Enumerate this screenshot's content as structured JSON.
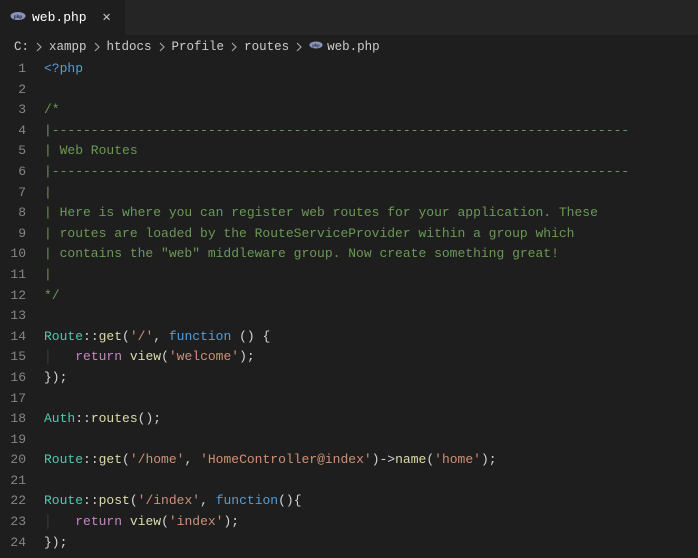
{
  "tab": {
    "filename": "web.php",
    "close_glyph": "✕"
  },
  "breadcrumb": {
    "items": [
      "C:",
      "xampp",
      "htdocs",
      "Profile",
      "routes",
      "web.php"
    ]
  },
  "code": {
    "lines": [
      {
        "n": 1,
        "tokens": [
          [
            "c-tag",
            "<?php"
          ]
        ]
      },
      {
        "n": 2,
        "tokens": []
      },
      {
        "n": 3,
        "tokens": [
          [
            "c-comment",
            "/*"
          ]
        ]
      },
      {
        "n": 4,
        "tokens": [
          [
            "c-comment",
            "|--------------------------------------------------------------------------"
          ]
        ]
      },
      {
        "n": 5,
        "tokens": [
          [
            "c-comment",
            "| Web Routes"
          ]
        ]
      },
      {
        "n": 6,
        "tokens": [
          [
            "c-comment",
            "|--------------------------------------------------------------------------"
          ]
        ]
      },
      {
        "n": 7,
        "tokens": [
          [
            "c-comment",
            "|"
          ]
        ]
      },
      {
        "n": 8,
        "tokens": [
          [
            "c-comment",
            "| Here is where you can register web routes for your application. These"
          ]
        ]
      },
      {
        "n": 9,
        "tokens": [
          [
            "c-comment",
            "| routes are loaded by the RouteServiceProvider within a group which"
          ]
        ]
      },
      {
        "n": 10,
        "tokens": [
          [
            "c-comment",
            "| contains the \"web\" middleware group. Now create something great!"
          ]
        ]
      },
      {
        "n": 11,
        "tokens": [
          [
            "c-comment",
            "|"
          ]
        ]
      },
      {
        "n": 12,
        "tokens": [
          [
            "c-comment",
            "*/"
          ]
        ]
      },
      {
        "n": 13,
        "tokens": []
      },
      {
        "n": 14,
        "tokens": [
          [
            "c-type",
            "Route"
          ],
          [
            "c-punct",
            "::"
          ],
          [
            "c-func",
            "get"
          ],
          [
            "c-punct",
            "("
          ],
          [
            "c-str",
            "'/'"
          ],
          [
            "c-punct",
            ", "
          ],
          [
            "c-keyword",
            "function"
          ],
          [
            "c-punct",
            " () {"
          ]
        ]
      },
      {
        "n": 15,
        "tokens": [
          [
            "guide",
            "│   "
          ],
          [
            "c-keyword2",
            "return"
          ],
          [
            "c-punct",
            " "
          ],
          [
            "c-func",
            "view"
          ],
          [
            "c-punct",
            "("
          ],
          [
            "c-str",
            "'welcome'"
          ],
          [
            "c-punct",
            ");"
          ]
        ]
      },
      {
        "n": 16,
        "tokens": [
          [
            "c-punct",
            "});"
          ]
        ]
      },
      {
        "n": 17,
        "tokens": []
      },
      {
        "n": 18,
        "tokens": [
          [
            "c-type",
            "Auth"
          ],
          [
            "c-punct",
            "::"
          ],
          [
            "c-func",
            "routes"
          ],
          [
            "c-punct",
            "();"
          ]
        ]
      },
      {
        "n": 19,
        "tokens": []
      },
      {
        "n": 20,
        "tokens": [
          [
            "c-type",
            "Route"
          ],
          [
            "c-punct",
            "::"
          ],
          [
            "c-func",
            "get"
          ],
          [
            "c-punct",
            "("
          ],
          [
            "c-str",
            "'/home'"
          ],
          [
            "c-punct",
            ", "
          ],
          [
            "c-str",
            "'HomeController@index'"
          ],
          [
            "c-punct",
            ")->"
          ],
          [
            "c-func",
            "name"
          ],
          [
            "c-punct",
            "("
          ],
          [
            "c-str",
            "'home'"
          ],
          [
            "c-punct",
            ");"
          ]
        ]
      },
      {
        "n": 21,
        "tokens": []
      },
      {
        "n": 22,
        "tokens": [
          [
            "c-type",
            "Route"
          ],
          [
            "c-punct",
            "::"
          ],
          [
            "c-func",
            "post"
          ],
          [
            "c-punct",
            "("
          ],
          [
            "c-str",
            "'/index'"
          ],
          [
            "c-punct",
            ", "
          ],
          [
            "c-keyword",
            "function"
          ],
          [
            "c-punct",
            "(){"
          ]
        ]
      },
      {
        "n": 23,
        "tokens": [
          [
            "guide",
            "│   "
          ],
          [
            "c-keyword2",
            "return"
          ],
          [
            "c-punct",
            " "
          ],
          [
            "c-func",
            "view"
          ],
          [
            "c-punct",
            "("
          ],
          [
            "c-str",
            "'index'"
          ],
          [
            "c-punct",
            ");"
          ]
        ]
      },
      {
        "n": 24,
        "tokens": [
          [
            "c-punct",
            "});"
          ]
        ]
      }
    ]
  }
}
